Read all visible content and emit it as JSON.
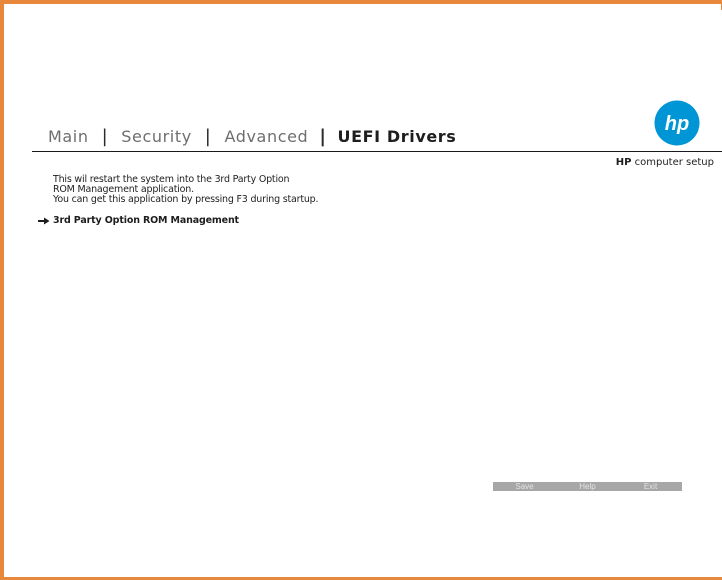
{
  "tabs": [
    {
      "label": "Main",
      "active": false
    },
    {
      "label": "Security",
      "active": false
    },
    {
      "label": "Advanced",
      "active": false
    },
    {
      "label": "UEFI Drivers",
      "active": true
    }
  ],
  "brand": {
    "logo_text": "hp",
    "bold": "HP",
    "rest": " computer setup"
  },
  "description": [
    "This wil restart the system into the 3rd Party Option",
    "ROM Management application.",
    "You can get this application by pressing F3 during startup."
  ],
  "menu": {
    "item_label": "3rd Party Option ROM Management",
    "icon": "arrow-right-icon"
  },
  "buttons": {
    "save": "Save",
    "help": "Help",
    "exit": "Exit"
  },
  "colors": {
    "frame": "#e8883a",
    "hp_blue": "#0096d6",
    "button_bar": "#a7a7a7"
  }
}
